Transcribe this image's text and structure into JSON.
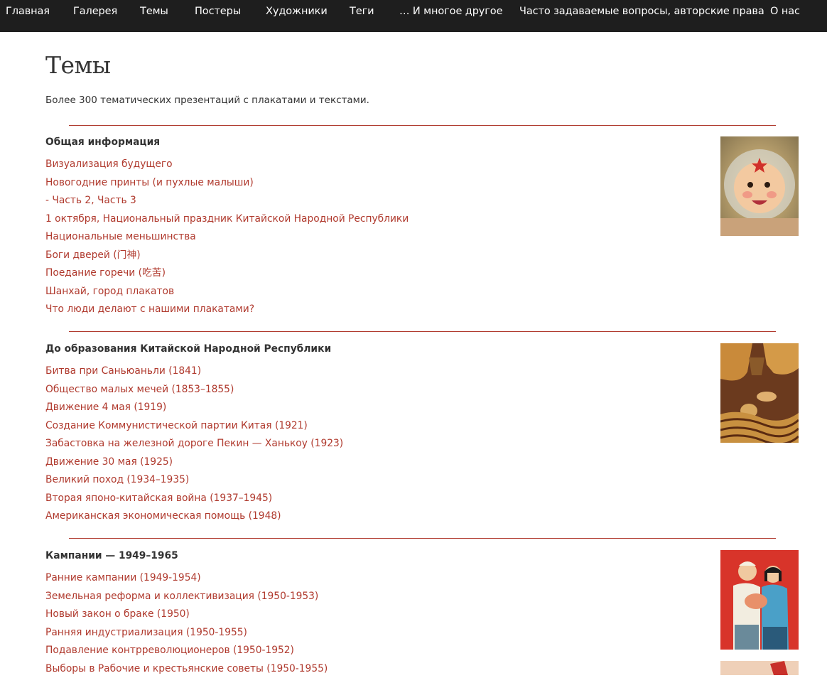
{
  "nav": [
    "Главная",
    "Галерея",
    "Темы",
    "Постеры",
    "Художники",
    "Теги",
    "… И многое другое",
    "Часто задаваемые вопросы, авторские права",
    "О нас"
  ],
  "page": {
    "title": "Темы",
    "intro": "Более 300 тематических презентаций с плакатами и текстами."
  },
  "sections": [
    {
      "heading": "Общая информация",
      "links": [
        "Визуализация будущего",
        "Новогодние принты (и пухлые малыши)",
        "- Часть 2, Часть 3",
        "1 октября, Национальный праздник Китайской Народной Республики",
        "Национальные меньшинства",
        "Боги дверей (门神)",
        "Поедание горечи (吃苦)",
        "Шанхай, город плакатов",
        "Что люди делают с нашими плакатами?"
      ]
    },
    {
      "heading": "До образования Китайской Народной Республики",
      "links": [
        "Битва при Саньюаньли (1841)",
        "Общество малых мечей (1853–1855)",
        "Движение 4 мая (1919)",
        "Создание Коммунистической партии Китая (1921)",
        "Забастовка на железной дороге Пекин — Ханькоу (1923)",
        "Движение 30 мая (1925)",
        "Великий поход (1934–1935)",
        "Вторая японо-китайская война (1937–1945)",
        "Американская экономическая помощь (1948)"
      ]
    },
    {
      "heading": "Кампании — 1949–1965",
      "links": [
        "Ранние кампании (1949-1954)",
        "Земельная реформа и коллективизация (1950-1953)",
        "Новый закон о браке (1950)",
        "Ранняя индустриализация (1950-1955)",
        "Подавление контрреволюционеров (1950-1952)",
        "Выборы в Рабочие и крестьянские советы (1950-1955)"
      ]
    }
  ],
  "colors": {
    "nav_bg": "#1e1e1e",
    "link": "#b03a2e",
    "divider": "#b03a2e",
    "text": "#333333"
  }
}
